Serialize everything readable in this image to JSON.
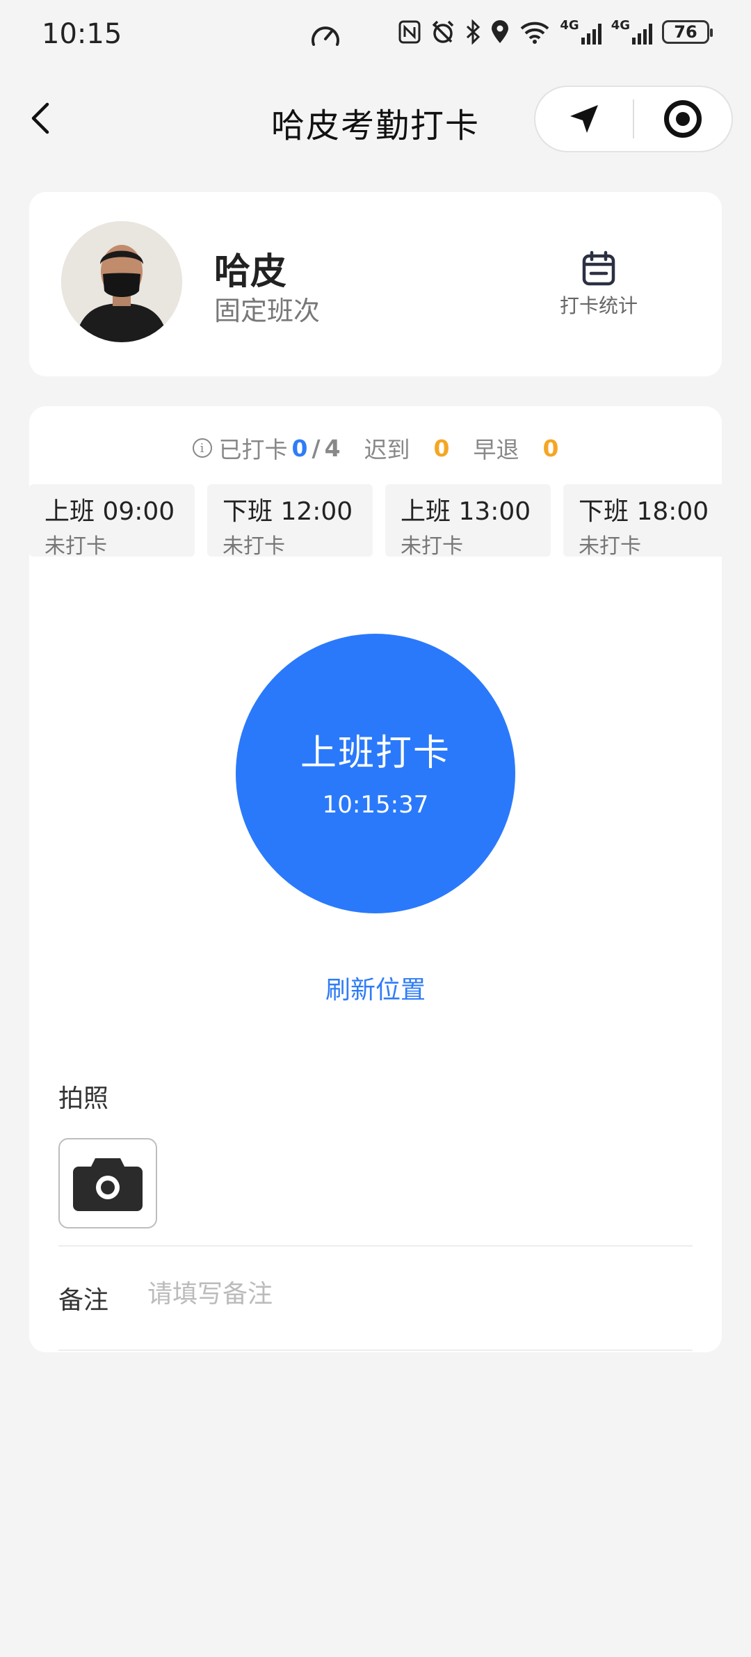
{
  "status_bar": {
    "time": "10:15",
    "network_labels": [
      "4G",
      "4G"
    ],
    "battery": "76",
    "icons": [
      "speed-icon",
      "nfc-icon",
      "alarm-icon",
      "bluetooth-icon",
      "location-icon",
      "wifi-icon",
      "signal-icon",
      "signal-icon",
      "battery-icon"
    ]
  },
  "nav": {
    "title": "哈皮考勤打卡",
    "back_icon": "chevron-left-icon",
    "capsule_icons": [
      "navigation-arrow-icon",
      "record-target-icon"
    ]
  },
  "profile": {
    "name": "哈皮",
    "shift": "固定班次",
    "stats_label": "打卡统计",
    "stats_icon": "calendar-icon"
  },
  "summary": {
    "punched_label": "已打卡",
    "punched_count": "0",
    "separator": "/",
    "punched_total": "4",
    "late_label": "迟到",
    "late_count": "0",
    "early_label": "早退",
    "early_count": "0"
  },
  "slots": [
    {
      "time_label": "上班 09:00",
      "status": "未打卡"
    },
    {
      "time_label": "下班 12:00",
      "status": "未打卡"
    },
    {
      "time_label": "上班 13:00",
      "status": "未打卡"
    },
    {
      "time_label": "下班 18:00",
      "status": "未打卡"
    }
  ],
  "punch": {
    "label": "上班打卡",
    "time": "10:15:37",
    "color": "#2a79fb"
  },
  "refresh_label": "刷新位置",
  "photo": {
    "label": "拍照",
    "icon": "camera-icon"
  },
  "remark": {
    "label": "备注",
    "placeholder": "请填写备注",
    "value": ""
  },
  "colors": {
    "accent": "#2f7cf6",
    "warning": "#f5a623",
    "background": "#f4f4f4"
  }
}
